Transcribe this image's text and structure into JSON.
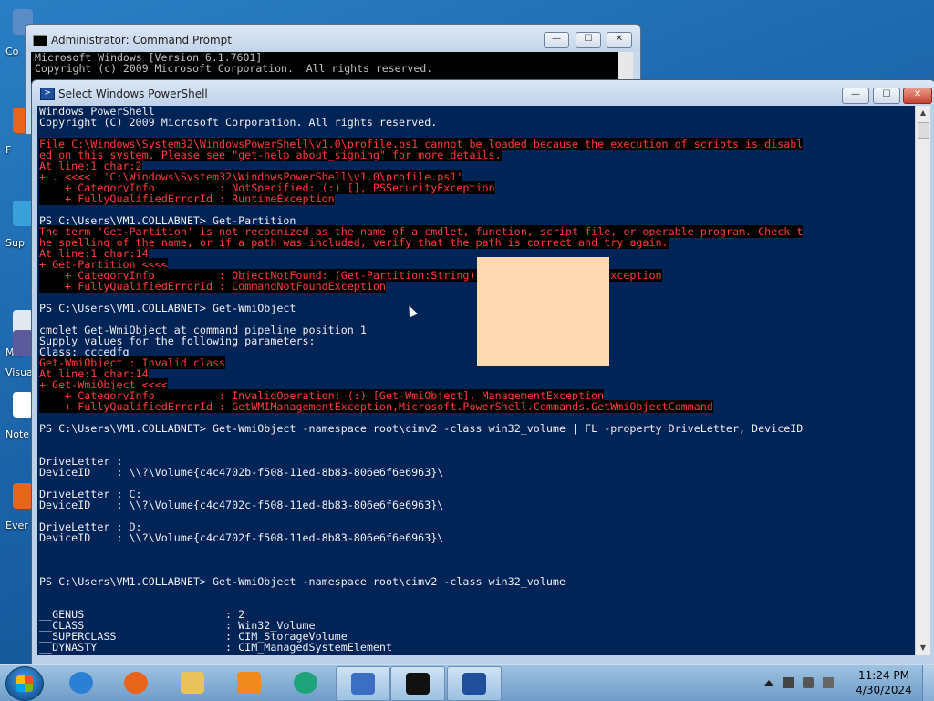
{
  "desktop": {
    "icons": [
      {
        "label": "Co"
      },
      {
        "label": "F"
      },
      {
        "label": "Sup"
      },
      {
        "label": "Mic"
      },
      {
        "label": "Visua"
      },
      {
        "label": "Note"
      },
      {
        "label": "Ever"
      }
    ]
  },
  "cmd_window": {
    "title": "Administrator: Command Prompt",
    "minimize": "—",
    "maximize": "☐",
    "close": "✕",
    "lines": [
      "Microsoft Windows [Version 6.1.7601]",
      "Copyright (c) 2009 Microsoft Corporation.  All rights reserved."
    ]
  },
  "ps_window": {
    "title": "Select Windows PowerShell",
    "minimize": "—",
    "maximize": "☐",
    "close": "✕",
    "lines": [
      {
        "text": "Windows PowerShell",
        "style": "normal"
      },
      {
        "text": "Copyright (C) 2009 Microsoft Corporation. All rights reserved.",
        "style": "normal"
      },
      {
        "text": "",
        "style": "normal"
      },
      {
        "text": "File C:\\Windows\\System32\\WindowsPowerShell\\v1.0\\profile.ps1 cannot be loaded because the execution of scripts is disabl",
        "style": "error"
      },
      {
        "text": "ed on this system. Please see \"get-help about_signing\" for more details.",
        "style": "error"
      },
      {
        "text": "At line:1 char:2",
        "style": "error"
      },
      {
        "text": "+ . <<<<  'C:\\Windows\\System32\\WindowsPowerShell\\v1.0\\profile.ps1'",
        "style": "error"
      },
      {
        "text": "    + CategoryInfo          : NotSpecified: (:) [], PSSecurityException",
        "style": "error"
      },
      {
        "text": "    + FullyQualifiedErrorId : RuntimeException",
        "style": "error"
      },
      {
        "text": "",
        "style": "normal"
      },
      {
        "text": "PS C:\\Users\\VM1.COLLABNET> Get-Partition",
        "style": "normal"
      },
      {
        "text": "The term 'Get-Partition' is not recognized as the name of a cmdlet, function, script file, or operable program. Check t",
        "style": "error"
      },
      {
        "text": "he spelling of the name, or if a path was included, verify that the path is correct and try again.",
        "style": "error"
      },
      {
        "text": "At line:1 char:14",
        "style": "error"
      },
      {
        "text": "+ Get-Partition <<<<",
        "style": "error"
      },
      {
        "text": "    + CategoryInfo          : ObjectNotFound: (Get-Partition:String) [], CommandNotFoundException",
        "style": "error"
      },
      {
        "text": "    + FullyQualifiedErrorId : CommandNotFoundException",
        "style": "error"
      },
      {
        "text": "",
        "style": "normal"
      },
      {
        "text": "PS C:\\Users\\VM1.COLLABNET> Get-WmiObject",
        "style": "normal"
      },
      {
        "text": "",
        "style": "normal"
      },
      {
        "text": "cmdlet Get-WmiObject at command pipeline position 1",
        "style": "normal"
      },
      {
        "text": "Supply values for the following parameters:",
        "style": "normal"
      },
      {
        "text": "Class: cccedfg",
        "style": "normal"
      },
      {
        "text": "Get-WmiObject : Invalid class",
        "style": "error"
      },
      {
        "text": "At line:1 char:14",
        "style": "error"
      },
      {
        "text": "+ Get-WmiObject <<<<",
        "style": "error"
      },
      {
        "text": "    + CategoryInfo          : InvalidOperation: (:) [Get-WmiObject], ManagementException",
        "style": "error"
      },
      {
        "text": "    + FullyQualifiedErrorId : GetWMIManagementException,Microsoft.PowerShell.Commands.GetWmiObjectCommand",
        "style": "error"
      },
      {
        "text": "",
        "style": "normal"
      },
      {
        "text": "PS C:\\Users\\VM1.COLLABNET> Get-WmiObject -namespace root\\cimv2 -class win32_volume | FL -property DriveLetter, DeviceID",
        "style": "normal"
      },
      {
        "text": "",
        "style": "normal"
      },
      {
        "text": "",
        "style": "normal"
      },
      {
        "text": "DriveLetter :",
        "style": "normal"
      },
      {
        "text": "DeviceID    : \\\\?\\Volume{c4c4702b-f508-11ed-8b83-806e6f6e6963}\\",
        "style": "normal"
      },
      {
        "text": "",
        "style": "normal"
      },
      {
        "text": "DriveLetter : C:",
        "style": "normal"
      },
      {
        "text": "DeviceID    : \\\\?\\Volume{c4c4702c-f508-11ed-8b83-806e6f6e6963}\\",
        "style": "normal"
      },
      {
        "text": "",
        "style": "normal"
      },
      {
        "text": "DriveLetter : D:",
        "style": "normal"
      },
      {
        "text": "DeviceID    : \\\\?\\Volume{c4c4702f-f508-11ed-8b83-806e6f6e6963}\\",
        "style": "normal"
      },
      {
        "text": "",
        "style": "normal"
      },
      {
        "text": "",
        "style": "normal"
      },
      {
        "text": "",
        "style": "normal"
      },
      {
        "text": "PS C:\\Users\\VM1.COLLABNET> Get-WmiObject -namespace root\\cimv2 -class win32_volume",
        "style": "normal"
      },
      {
        "text": "",
        "style": "normal"
      },
      {
        "text": "",
        "style": "normal"
      },
      {
        "text": "__GENUS                      : 2",
        "style": "normal"
      },
      {
        "text": "__CLASS                      : Win32_Volume",
        "style": "normal"
      },
      {
        "text": "__SUPERCLASS                 : CIM_StorageVolume",
        "style": "normal"
      },
      {
        "text": "__DYNASTY                    : CIM_ManagedSystemElement",
        "style": "normal"
      }
    ]
  },
  "taskbar": {
    "apps": [
      {
        "name": "internet-explorer-icon",
        "active": false,
        "color": "#2b7fd4"
      },
      {
        "name": "firefox-icon",
        "active": false,
        "color": "#e8641b"
      },
      {
        "name": "file-explorer-icon",
        "active": false,
        "color": "#e8c25a"
      },
      {
        "name": "media-player-icon",
        "active": false,
        "color": "#f08a1c"
      },
      {
        "name": "app-globe-icon",
        "active": false,
        "color": "#1fa37a"
      },
      {
        "name": "task-checklist-icon",
        "active": true,
        "color": "#3a6fc4"
      },
      {
        "name": "command-prompt-icon",
        "active": true,
        "color": "#111111"
      },
      {
        "name": "powershell-icon",
        "active": true,
        "color": "#1f4f9a"
      }
    ],
    "time": "11:24 PM",
    "date": "4/30/2024"
  }
}
